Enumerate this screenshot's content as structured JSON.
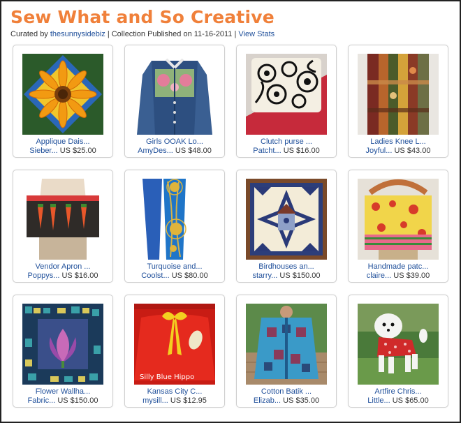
{
  "collection": {
    "title": "Sew What and So Creative",
    "curated_prefix": "Curated by",
    "curator": "thesunnysidebiz",
    "published": "| Collection Published on 11-16-2011 |",
    "view_stats": "View Stats"
  },
  "items": [
    {
      "title": "Applique Dais...",
      "seller": "Sieber...",
      "price": "US $25.00",
      "image": "sunflower-quilt"
    },
    {
      "title": "Girls OOAK Lo...",
      "seller": "AmyDes...",
      "price": "US $48.00",
      "image": "denim-jacket"
    },
    {
      "title": "Clutch purse ...",
      "seller": "Patcht...",
      "price": "US $16.00",
      "image": "clutch-purse"
    },
    {
      "title": "Ladies Knee L...",
      "seller": "Joyful...",
      "price": "US $43.00",
      "image": "patchwork-skirt"
    },
    {
      "title": "Vendor Apron ...",
      "seller": "Poppys...",
      "price": "US $16.00",
      "image": "vendor-apron"
    },
    {
      "title": "Turquoise and...",
      "seller": "Coolst...",
      "price": "US $80.00",
      "image": "blue-scarf"
    },
    {
      "title": "Birdhouses an...",
      "seller": "starry...",
      "price": "US $150.00",
      "image": "birdhouse-quilt"
    },
    {
      "title": "Handmade patc...",
      "seller": "claire...",
      "price": "US $39.00",
      "image": "patchwork-bag"
    },
    {
      "title": "Flower Wallha...",
      "seller": "Fabric...",
      "price": "US $150.00",
      "image": "flower-wallhanging"
    },
    {
      "title": "Kansas City C...",
      "seller": "mysill...",
      "price": "US $12.95",
      "image": "red-tutu",
      "image_text": "Silly Blue Hippo"
    },
    {
      "title": "Cotton Batik ...",
      "seller": "Elizab...",
      "price": "US $35.00",
      "image": "batik-jacket"
    },
    {
      "title": "Artfire Chris...",
      "seller": "Little...",
      "price": "US $65.00",
      "image": "dog-dress"
    }
  ]
}
